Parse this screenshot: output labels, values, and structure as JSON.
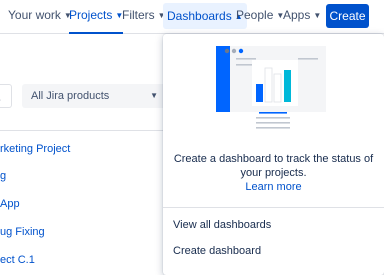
{
  "nav": {
    "your_work": "Your work",
    "projects": "Projects",
    "filters": "Filters",
    "dashboards": "Dashboards",
    "people": "People",
    "apps": "Apps",
    "create": "Create"
  },
  "filter_bar": {
    "select_value": "All Jira products"
  },
  "projects": [
    "rketing Project",
    "g",
    "App",
    "ug Fixing",
    "ect C.1"
  ],
  "dropdown": {
    "empty_text_line1": "Create a dashboard to track the status of",
    "empty_text_line2": "your projects.",
    "learn_more": "Learn more",
    "items": [
      "View all dashboards",
      "Create dashboard"
    ]
  },
  "colors": {
    "accent": "#0052cc",
    "illustration_blue": "#0065ff",
    "illustration_cyan": "#00b8d9",
    "illustration_bg": "#f4f5f7"
  }
}
